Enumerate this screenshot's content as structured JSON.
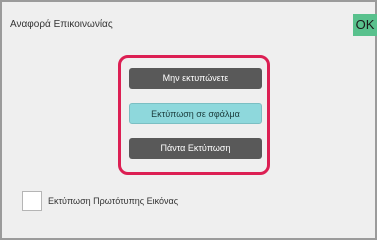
{
  "screen": {
    "title": "Αναφορά Επικοινωνίας",
    "ok_label": "OK"
  },
  "options": {
    "items": [
      {
        "label": "Μην εκτυπώνετε",
        "selected": false
      },
      {
        "label": "Εκτύπωση σε σφάλμα",
        "selected": true
      },
      {
        "label": "Πάντα Εκτύπωση",
        "selected": false
      }
    ]
  },
  "checkbox": {
    "label": "Εκτύπωση Πρωτότυπης Εικόνας",
    "checked": false
  },
  "colors": {
    "ok_button": "#59c18d",
    "highlight_frame": "#dc1f53",
    "option_default": "#595959",
    "option_selected": "#8ed8dc"
  }
}
